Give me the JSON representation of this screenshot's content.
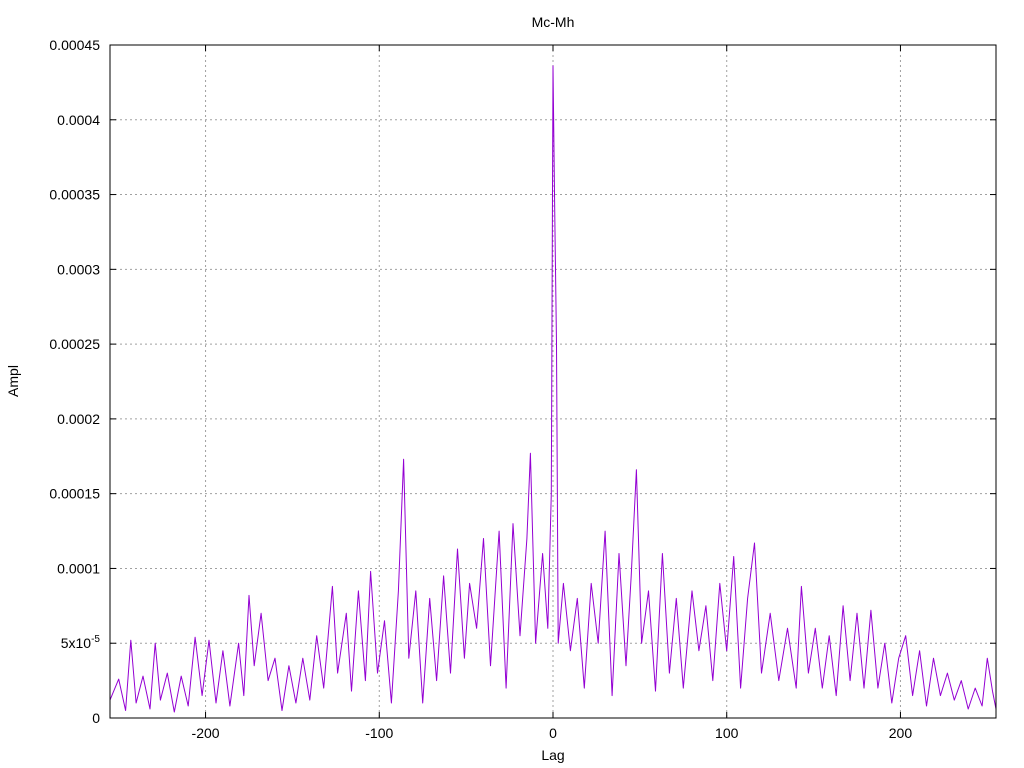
{
  "chart_data": {
    "type": "line",
    "title": "Mc-Mh",
    "xlabel": "Lag",
    "ylabel": "Ampl",
    "xlim": [
      -255,
      255
    ],
    "ylim": [
      0,
      0.00045
    ],
    "x_ticks": [
      -200,
      -100,
      0,
      100,
      200
    ],
    "x_tick_labels": [
      "-200",
      "-100",
      "0",
      "100",
      "200"
    ],
    "y_ticks": [
      0,
      5e-05,
      0.0001,
      0.00015,
      0.0002,
      0.00025,
      0.0003,
      0.00035,
      0.0004,
      0.00045
    ],
    "y_tick_labels": [
      "0",
      "5x10-5",
      "0.0001",
      "0.00015",
      "0.0002",
      "0.00025",
      "0.0003",
      "0.00035",
      "0.0004",
      "0.00045"
    ],
    "grid": true,
    "legend": "none",
    "series": [
      {
        "color": "#9400d3",
        "points": [
          [
            -255,
            1.2e-05
          ],
          [
            -250,
            2.6e-05
          ],
          [
            -246,
            5e-06
          ],
          [
            -243,
            5.2e-05
          ],
          [
            -240,
            1e-05
          ],
          [
            -236,
            2.8e-05
          ],
          [
            -232,
            6e-06
          ],
          [
            -229,
            5e-05
          ],
          [
            -226,
            1.2e-05
          ],
          [
            -222,
            3e-05
          ],
          [
            -218,
            4e-06
          ],
          [
            -214,
            2.8e-05
          ],
          [
            -210,
            8e-06
          ],
          [
            -206,
            5.4e-05
          ],
          [
            -202,
            1.5e-05
          ],
          [
            -198,
            5.2e-05
          ],
          [
            -194,
            1e-05
          ],
          [
            -190,
            4.5e-05
          ],
          [
            -186,
            8e-06
          ],
          [
            -181,
            5e-05
          ],
          [
            -178,
            1.5e-05
          ],
          [
            -175,
            8.2e-05
          ],
          [
            -172,
            3.5e-05
          ],
          [
            -168,
            7e-05
          ],
          [
            -164,
            2.5e-05
          ],
          [
            -160,
            4e-05
          ],
          [
            -156,
            5e-06
          ],
          [
            -152,
            3.5e-05
          ],
          [
            -148,
            1e-05
          ],
          [
            -144,
            4e-05
          ],
          [
            -140,
            1.2e-05
          ],
          [
            -136,
            5.5e-05
          ],
          [
            -132,
            2e-05
          ],
          [
            -127,
            8.8e-05
          ],
          [
            -124,
            3e-05
          ],
          [
            -119,
            7e-05
          ],
          [
            -116,
            1.8e-05
          ],
          [
            -112,
            8.5e-05
          ],
          [
            -108,
            2.5e-05
          ],
          [
            -105,
            9.8e-05
          ],
          [
            -101,
            3e-05
          ],
          [
            -97,
            6.5e-05
          ],
          [
            -93,
            1e-05
          ],
          [
            -89,
            8.5e-05
          ],
          [
            -86,
            0.000173
          ],
          [
            -83,
            4e-05
          ],
          [
            -79,
            8.5e-05
          ],
          [
            -75,
            1e-05
          ],
          [
            -71,
            8e-05
          ],
          [
            -67,
            2.5e-05
          ],
          [
            -63,
            9.5e-05
          ],
          [
            -59,
            3e-05
          ],
          [
            -55,
            0.000113
          ],
          [
            -51,
            4e-05
          ],
          [
            -48,
            9e-05
          ],
          [
            -44,
            6e-05
          ],
          [
            -40,
            0.00012
          ],
          [
            -36,
            3.5e-05
          ],
          [
            -31,
            0.000125
          ],
          [
            -27,
            2e-05
          ],
          [
            -23,
            0.00013
          ],
          [
            -19,
            5.5e-05
          ],
          [
            -15,
            0.00012
          ],
          [
            -13,
            0.000177
          ],
          [
            -10,
            5e-05
          ],
          [
            -6,
            0.00011
          ],
          [
            -3,
            6e-05
          ],
          [
            -1,
            0.00015
          ],
          [
            0,
            0.000436
          ],
          [
            1,
            0.00034
          ],
          [
            2,
            0.00025
          ],
          [
            3,
            5e-05
          ],
          [
            6,
            9e-05
          ],
          [
            10,
            4.5e-05
          ],
          [
            14,
            8e-05
          ],
          [
            18,
            2e-05
          ],
          [
            22,
            9e-05
          ],
          [
            26,
            5e-05
          ],
          [
            30,
            0.000125
          ],
          [
            34,
            1.5e-05
          ],
          [
            38,
            0.00011
          ],
          [
            42,
            3.5e-05
          ],
          [
            45,
            9.5e-05
          ],
          [
            48,
            0.000166
          ],
          [
            51,
            5e-05
          ],
          [
            55,
            8.5e-05
          ],
          [
            59,
            1.8e-05
          ],
          [
            63,
            0.00011
          ],
          [
            67,
            3e-05
          ],
          [
            71,
            8e-05
          ],
          [
            75,
            2e-05
          ],
          [
            80,
            8.5e-05
          ],
          [
            84,
            4.5e-05
          ],
          [
            88,
            7.5e-05
          ],
          [
            92,
            2.5e-05
          ],
          [
            96,
            9e-05
          ],
          [
            100,
            4.5e-05
          ],
          [
            104,
            0.000108
          ],
          [
            108,
            2e-05
          ],
          [
            112,
            8e-05
          ],
          [
            116,
            0.000117
          ],
          [
            120,
            3e-05
          ],
          [
            125,
            7e-05
          ],
          [
            130,
            2.5e-05
          ],
          [
            135,
            6e-05
          ],
          [
            140,
            2e-05
          ],
          [
            143,
            8.8e-05
          ],
          [
            147,
            3e-05
          ],
          [
            151,
            6e-05
          ],
          [
            155,
            2e-05
          ],
          [
            159,
            5.5e-05
          ],
          [
            163,
            1.5e-05
          ],
          [
            167,
            7.5e-05
          ],
          [
            171,
            2.5e-05
          ],
          [
            175,
            7e-05
          ],
          [
            179,
            2e-05
          ],
          [
            183,
            7.2e-05
          ],
          [
            187,
            2e-05
          ],
          [
            191,
            5e-05
          ],
          [
            195,
            1e-05
          ],
          [
            199,
            4e-05
          ],
          [
            203,
            5.5e-05
          ],
          [
            207,
            1.5e-05
          ],
          [
            211,
            4.5e-05
          ],
          [
            215,
            8e-06
          ],
          [
            219,
            4e-05
          ],
          [
            223,
            1.5e-05
          ],
          [
            227,
            3e-05
          ],
          [
            231,
            1.2e-05
          ],
          [
            235,
            2.5e-05
          ],
          [
            239,
            6e-06
          ],
          [
            243,
            2e-05
          ],
          [
            247,
            8e-06
          ],
          [
            250,
            4e-05
          ],
          [
            253,
            1.8e-05
          ],
          [
            255,
            6e-06
          ]
        ]
      }
    ]
  }
}
